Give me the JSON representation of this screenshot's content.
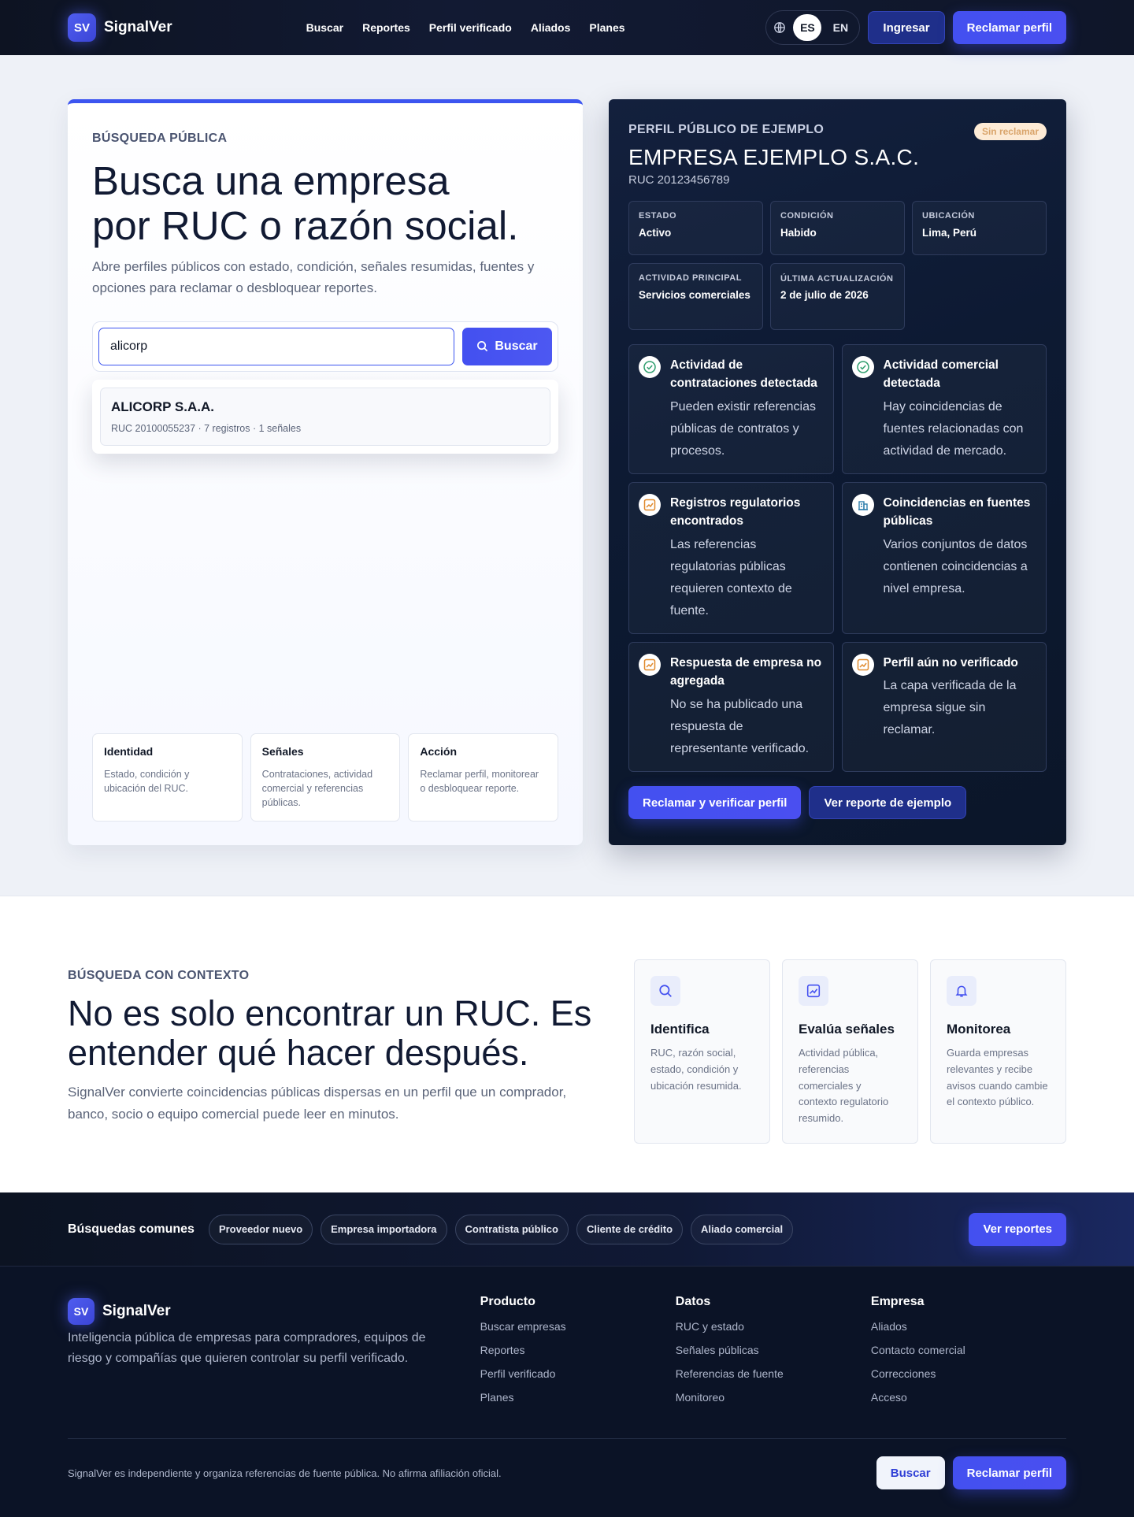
{
  "header": {
    "brand_mark": "SV",
    "brand_name": "SignalVer",
    "nav": [
      "Buscar",
      "Reportes",
      "Perfil verificado",
      "Aliados",
      "Planes"
    ],
    "lang_options": [
      "ES",
      "EN"
    ],
    "lang_active": "ES",
    "login": "Ingresar",
    "claim": "Reclamar perfil"
  },
  "search_card": {
    "eyebrow": "BÚSQUEDA PÚBLICA",
    "title_line1": "Busca una empresa",
    "title_line2": "por RUC o razón social.",
    "subtitle": "Abre perfiles públicos con estado, condición, señales resumidas, fuentes y opciones para reclamar o desbloquear reportes.",
    "input_value": "alicorp",
    "search_button": "Buscar",
    "result": {
      "name": "ALICORP S.A.A.",
      "meta": "RUC 20100055237 · 7 registros · 1 señales"
    },
    "mini_cards": [
      {
        "title": "Identidad",
        "desc": "Estado, condición y ubicación del RUC."
      },
      {
        "title": "Señales",
        "desc": "Contrataciones, actividad comercial y referencias públicas."
      },
      {
        "title": "Acción",
        "desc": "Reclamar perfil, monitorear o desbloquear reporte."
      }
    ]
  },
  "profile_card": {
    "eyebrow": "PERFIL PÚBLICO DE EJEMPLO",
    "badge": "Sin reclamar",
    "name": "EMPRESA EJEMPLO S.A.C.",
    "ruc": "RUC 20123456789",
    "facts": [
      {
        "label": "ESTADO",
        "value": "Activo"
      },
      {
        "label": "CONDICIÓN",
        "value": "Habido"
      },
      {
        "label": "UBICACIÓN",
        "value": "Lima, Perú"
      },
      {
        "label": "ACTIVIDAD PRINCIPAL",
        "value": "Servicios comerciales"
      },
      {
        "label": "ÚLTIMA ACTUALIZACIÓN",
        "value": "2 de julio de 2026"
      }
    ],
    "signals": [
      {
        "icon": "check-circle-icon",
        "title": "Actividad de contrataciones detectada",
        "desc": "Pueden existir referencias públicas de contratos y procesos."
      },
      {
        "icon": "check-circle-icon",
        "title": "Actividad comercial detectada",
        "desc": "Hay coincidencias de fuentes relacionadas con actividad de mercado."
      },
      {
        "icon": "trend-chart-icon",
        "title": "Registros regulatorios encontrados",
        "desc": "Las referencias regulatorias públicas requieren contexto de fuente."
      },
      {
        "icon": "building-icon",
        "title": "Coincidencias en fuentes públicas",
        "desc": "Varios conjuntos de datos contienen coincidencias a nivel empresa."
      },
      {
        "icon": "trend-chart-icon",
        "title": "Respuesta de empresa no agregada",
        "desc": "No se ha publicado una respuesta de representante verificado."
      },
      {
        "icon": "trend-chart-icon",
        "title": "Perfil aún no verificado",
        "desc": "La capa verificada de la empresa sigue sin reclamar."
      }
    ],
    "claim_button": "Reclamar y verificar perfil",
    "sample_button": "Ver reporte de ejemplo"
  },
  "context": {
    "eyebrow": "BÚSQUEDA CON CONTEXTO",
    "title_line1": "No es solo encontrar un RUC. Es",
    "title_line2": "entender qué hacer después.",
    "subtitle": "SignalVer convierte coincidencias públicas dispersas en un perfil que un comprador, banco, socio o equipo comercial puede leer en minutos.",
    "cards": [
      {
        "icon": "search-icon",
        "title": "Identifica",
        "desc": "RUC, razón social, estado, condición y ubicación resumida."
      },
      {
        "icon": "trend-chart-icon",
        "title": "Evalúa señales",
        "desc": "Actividad pública, referencias comerciales y contexto regulatorio resumido."
      },
      {
        "icon": "bell-icon",
        "title": "Monitorea",
        "desc": "Guarda empresas relevantes y recibe avisos cuando cambie el contexto público."
      }
    ]
  },
  "common": {
    "title": "Búsquedas comunes",
    "chips": [
      "Proveedor nuevo",
      "Empresa importadora",
      "Contratista público",
      "Cliente de crédito",
      "Aliado comercial"
    ],
    "button": "Ver reportes"
  },
  "footer": {
    "brand_mark": "SV",
    "brand_name": "SignalVer",
    "desc": "Inteligencia pública de empresas para compradores, equipos de riesgo y compañías que quieren controlar su perfil verificado.",
    "columns": [
      {
        "title": "Producto",
        "links": [
          "Buscar empresas",
          "Reportes",
          "Perfil verificado",
          "Planes"
        ]
      },
      {
        "title": "Datos",
        "links": [
          "RUC y estado",
          "Señales públicas",
          "Referencias de fuente",
          "Monitoreo"
        ]
      },
      {
        "title": "Empresa",
        "links": [
          "Aliados",
          "Contacto comercial",
          "Correcciones",
          "Acceso"
        ]
      }
    ],
    "note": "SignalVer es independiente y organiza referencias de fuente pública. No afirma afiliación oficial.",
    "search_button": "Buscar",
    "claim_button": "Reclamar perfil"
  },
  "colors": {
    "accent": "#4350f0",
    "dark_bg": "#0b1326",
    "profile_bg": "#0d1a33",
    "warn": "#e08a2e",
    "success": "#2f9e6e"
  }
}
